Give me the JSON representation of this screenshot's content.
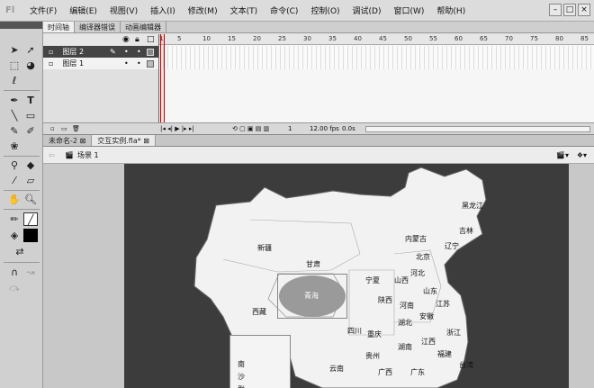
{
  "app": {
    "logo": "Fl"
  },
  "menu": [
    "文件(F)",
    "编辑(E)",
    "视图(V)",
    "插入(I)",
    "修改(M)",
    "文本(T)",
    "命令(C)",
    "控制(O)",
    "调试(D)",
    "窗口(W)",
    "帮助(H)"
  ],
  "timeline": {
    "tabs": [
      "时间轴",
      "编译器错误",
      "动画编辑器"
    ],
    "layers": [
      {
        "name": "图层 2"
      },
      {
        "name": "图层 1"
      }
    ],
    "ruler": [
      "1",
      "5",
      "10",
      "15",
      "20",
      "25",
      "30",
      "35",
      "40",
      "45",
      "50",
      "55",
      "60",
      "65",
      "70",
      "75",
      "80",
      "85"
    ],
    "status": {
      "frame": "1",
      "fps": "12.00 fps",
      "time": "0.0s"
    }
  },
  "doc_tabs": [
    "未命名-2",
    "交互实例.fla*"
  ],
  "scene": "场景 1",
  "map": {
    "provinces": [
      "黑龙江",
      "吉林",
      "辽宁",
      "内蒙古",
      "北京",
      "新疆",
      "甘肃",
      "青海",
      "宁夏",
      "山西",
      "河北",
      "山东",
      "西藏",
      "陕西",
      "河南",
      "江苏",
      "湖北",
      "安徽",
      "四川",
      "重庆",
      "湖南",
      "浙江",
      "江西",
      "贵州",
      "福建",
      "云南",
      "广西",
      "广东",
      "台湾"
    ],
    "inset": [
      "南",
      "沙",
      "群"
    ]
  }
}
